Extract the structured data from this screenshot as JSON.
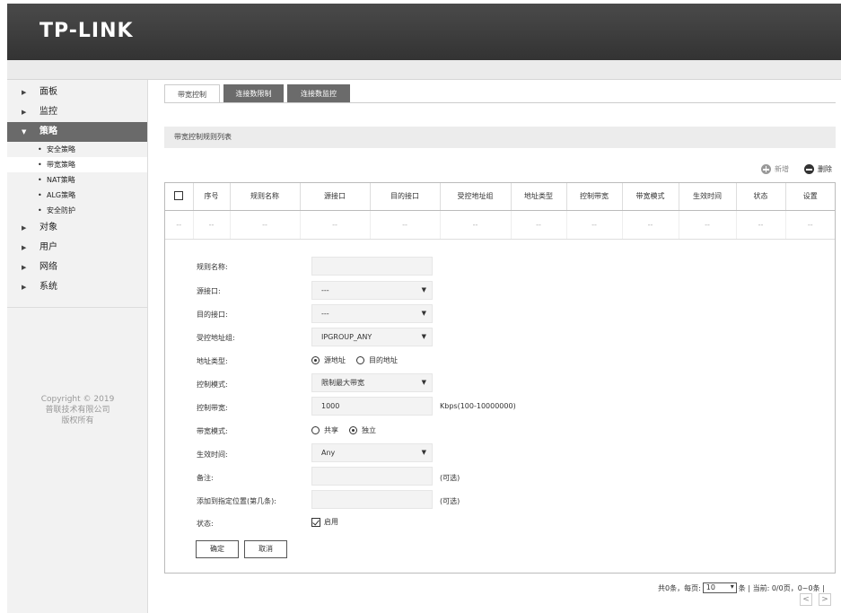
{
  "header": {
    "logo": "TP-LINK"
  },
  "sidebar": {
    "items": [
      {
        "label": "面板"
      },
      {
        "label": "监控"
      },
      {
        "label": "策略"
      },
      {
        "label": "对象"
      },
      {
        "label": "用户"
      },
      {
        "label": "网络"
      },
      {
        "label": "系统"
      }
    ],
    "sub_items": [
      {
        "label": "安全策略"
      },
      {
        "label": "带宽策略"
      },
      {
        "label": "NAT策略"
      },
      {
        "label": "ALG策略"
      },
      {
        "label": "安全防护"
      }
    ],
    "copyright": [
      "Copyright © 2019",
      "普联技术有限公司",
      "版权所有"
    ]
  },
  "tabs": [
    {
      "label": "带宽控制"
    },
    {
      "label": "连接数限制"
    },
    {
      "label": "连接数监控"
    }
  ],
  "section_title": "带宽控制规则列表",
  "toolbar": {
    "add": "新增",
    "delete": "删除"
  },
  "table": {
    "columns": [
      "序号",
      "规则名称",
      "源接口",
      "目的接口",
      "受控地址组",
      "地址类型",
      "控制带宽",
      "带宽模式",
      "生效时间",
      "状态",
      "设置"
    ],
    "empty_cell": "--"
  },
  "form": {
    "rule_name": {
      "label": "规则名称:",
      "value": ""
    },
    "src_if": {
      "label": "源接口:",
      "value": "---"
    },
    "dst_if": {
      "label": "目的接口:",
      "value": "---"
    },
    "addr_group": {
      "label": "受控地址组:",
      "value": "IPGROUP_ANY"
    },
    "addr_type": {
      "label": "地址类型:",
      "options": [
        "源地址",
        "目的地址"
      ],
      "selected": "源地址"
    },
    "ctrl_mode": {
      "label": "控制模式:",
      "value": "限制最大带宽"
    },
    "ctrl_bw": {
      "label": "控制带宽:",
      "value": "1000",
      "hint": "Kbps(100-10000000)"
    },
    "bw_mode": {
      "label": "带宽模式:",
      "options": [
        "共享",
        "独立"
      ],
      "selected": "独立"
    },
    "time": {
      "label": "生效时间:",
      "value": "Any"
    },
    "note": {
      "label": "备注:",
      "value": "",
      "hint": "(可选)"
    },
    "position": {
      "label": "添加到指定位置(第几条):",
      "value": "",
      "hint": "(可选)"
    },
    "status": {
      "label": "状态:",
      "check_label": "启用",
      "checked": true
    },
    "ok": "确定",
    "cancel": "取消"
  },
  "pager": {
    "prefix": "共0条，每页:",
    "per_page": "10",
    "suffix": "条 | 当前: 0/0页，0~0条 |",
    "prev": "<",
    "next": ">"
  }
}
